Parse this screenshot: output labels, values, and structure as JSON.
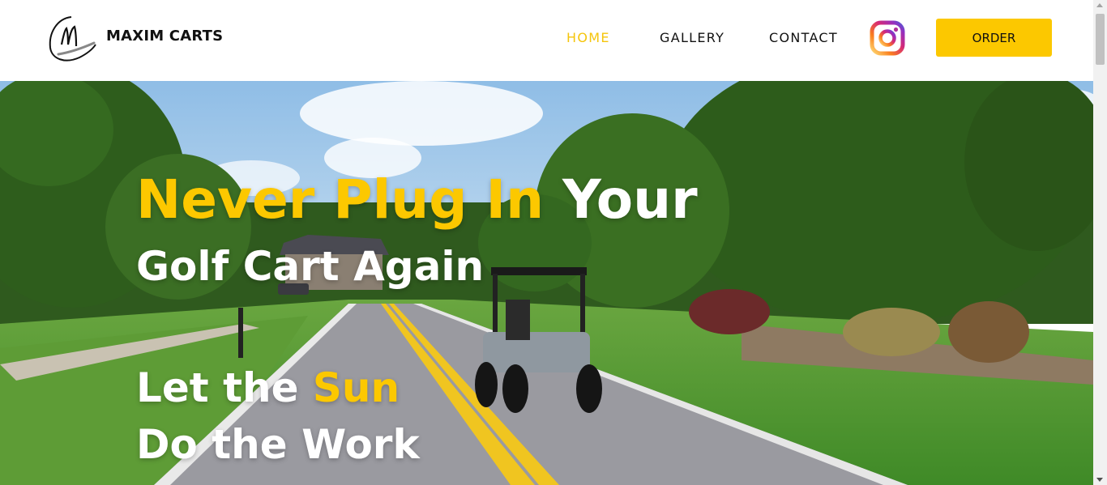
{
  "header": {
    "brand": "MAXIM CARTS",
    "nav": [
      {
        "label": "HOME",
        "active": true
      },
      {
        "label": "GALLERY",
        "active": false
      },
      {
        "label": "CONTACT",
        "active": false
      }
    ],
    "social_icon": "instagram-icon",
    "order_label": "ORDER"
  },
  "hero": {
    "line1_yellow": "Never Plug In",
    "line1_white": " Your",
    "line2": "Golf Cart Again",
    "line3_white": "Let the ",
    "line3_yellow": "Sun",
    "line4": "Do the Work",
    "background": "golf-cart-on-road-photo"
  },
  "colors": {
    "accent": "#fcc800",
    "text_dark": "#111111",
    "text_light": "#ffffff"
  }
}
